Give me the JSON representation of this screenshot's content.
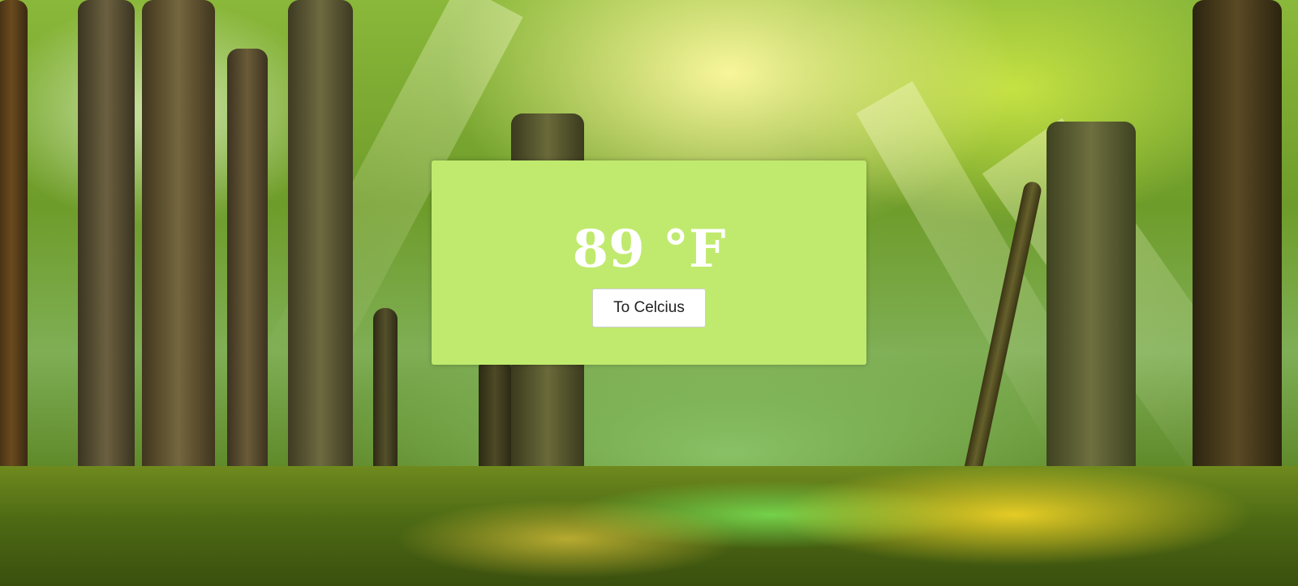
{
  "background": {
    "scene": "sunlit-forest",
    "accent_color": "#c0ea6e"
  },
  "widget": {
    "temperature_value": "89",
    "temperature_unit": "°F",
    "temperature_display": "89 °F",
    "toggle_button_label": "To Celcius",
    "panel_color": "#c0ea6e",
    "text_color": "#ffffff"
  }
}
